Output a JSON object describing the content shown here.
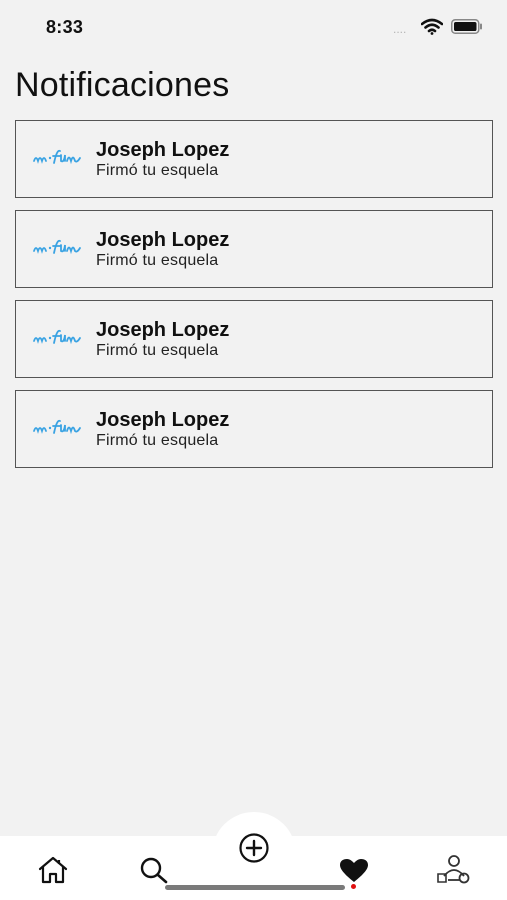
{
  "status_bar": {
    "time": "8:33",
    "signal_dots": "....",
    "icons": [
      "wifi-icon",
      "battery-icon"
    ]
  },
  "header": {
    "title": "Notificaciones"
  },
  "notifications": [
    {
      "logo_text": "m·fun",
      "name": "Joseph Lopez",
      "action": "Firmó tu esquela"
    },
    {
      "logo_text": "m·fun",
      "name": "Joseph Lopez",
      "action": "Firmó tu esquela"
    },
    {
      "logo_text": "m·fun",
      "name": "Joseph Lopez",
      "action": "Firmó tu esquela"
    },
    {
      "logo_text": "m·fun",
      "name": "Joseph Lopez",
      "action": "Firmó tu esquela"
    }
  ],
  "tab_bar": {
    "items": [
      {
        "icon": "home-icon"
      },
      {
        "icon": "search-icon"
      },
      {
        "icon": "plus-circle-icon"
      },
      {
        "icon": "heart-icon",
        "badge_color": "#e01010"
      },
      {
        "icon": "profile-icon"
      }
    ]
  },
  "colors": {
    "background": "#f2f2f2",
    "logo_accent": "#3aa3e3",
    "card_border": "#555555",
    "badge": "#e01010"
  }
}
